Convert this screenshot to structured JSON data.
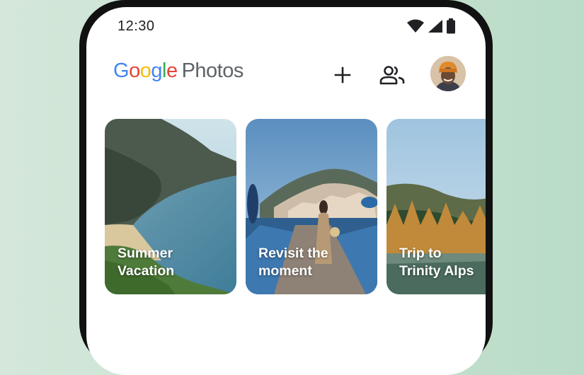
{
  "status_bar": {
    "time": "12:30",
    "icons": [
      "wifi-icon",
      "signal-icon",
      "battery-icon"
    ]
  },
  "header": {
    "logo_google": [
      "G",
      "o",
      "o",
      "g",
      "l",
      "e"
    ],
    "logo_google_colors": [
      "#4285F4",
      "#EA4335",
      "#FBBC05",
      "#4285F4",
      "#34A853",
      "#EA4335"
    ],
    "logo_photos": "Photos",
    "actions": [
      "add-icon",
      "sharing-icon",
      "avatar"
    ]
  },
  "memories": [
    {
      "title": "Summer\nVacation",
      "scene": "coast"
    },
    {
      "title": "Revisit the\nmoment",
      "scene": "village"
    },
    {
      "title": "Trip to\nTrinity Alps",
      "scene": "lake"
    }
  ],
  "colors": {
    "background": "#c9e3d2",
    "phone_frame": "#111111",
    "text_primary": "#202124",
    "text_secondary": "#5f6368"
  }
}
